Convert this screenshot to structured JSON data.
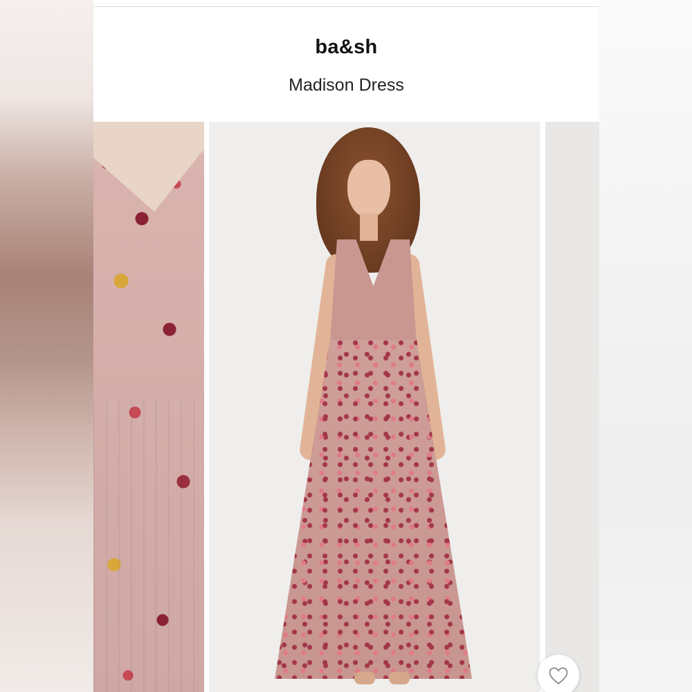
{
  "product": {
    "brand": "ba&sh",
    "name": "Madison Dress"
  },
  "gallery": {
    "slides": [
      "detail-closeup",
      "model-full-length",
      "next-image-partial"
    ],
    "active_index": 1
  },
  "actions": {
    "favorite_icon": "heart-outline-icon"
  },
  "colors": {
    "background": "#ffffff",
    "text": "#111111",
    "divider": "#d9d9d9"
  }
}
